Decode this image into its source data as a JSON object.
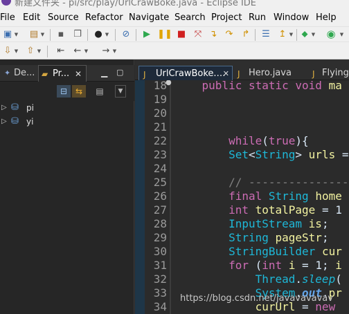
{
  "window": {
    "title": "新建文件夹 - pi/src/play/UrlCrawBoke.java - Eclipse IDE"
  },
  "menubar": [
    "File",
    "Edit",
    "Source",
    "Refactor",
    "Navigate",
    "Search",
    "Project",
    "Run",
    "Window",
    "Help"
  ],
  "left_panel": {
    "tabs": [
      {
        "label": "De..."
      },
      {
        "label": "Pr..."
      }
    ],
    "tree": [
      {
        "label": "pi"
      },
      {
        "label": "yi"
      }
    ]
  },
  "editor": {
    "tabs": [
      {
        "label": "UrlCrawBoke.…"
      },
      {
        "label": "Hero.java"
      },
      {
        "label": "FlyingO"
      }
    ],
    "lines": [
      {
        "n": "18",
        "code": "    public static void ma"
      },
      {
        "n": "19",
        "code": ""
      },
      {
        "n": "20",
        "code": ""
      },
      {
        "n": "21",
        "code": ""
      },
      {
        "n": "22",
        "code": "        while(true){"
      },
      {
        "n": "23",
        "code": "        Set<String> urls ="
      },
      {
        "n": "24",
        "code": ""
      },
      {
        "n": "25",
        "code": "        // ----------------"
      },
      {
        "n": "26",
        "code": "        final String home"
      },
      {
        "n": "27",
        "code": "        int totalPage = 1"
      },
      {
        "n": "28",
        "code": "        InputStream is;"
      },
      {
        "n": "29",
        "code": "        String pageStr;"
      },
      {
        "n": "30",
        "code": "        StringBuilder cur"
      },
      {
        "n": "31",
        "code": "        for (int i = 1; i"
      },
      {
        "n": "32",
        "code": "            Thread.sleep("
      },
      {
        "n": "33",
        "code": "            System.out.pr"
      },
      {
        "n": "34",
        "code": "            curUrl = new"
      }
    ]
  },
  "watermark": "https://blog.csdn.net/javavavavav"
}
